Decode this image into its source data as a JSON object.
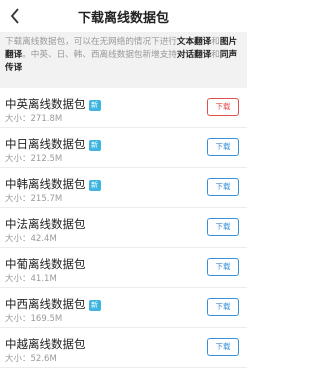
{
  "header": {
    "title": "下载离线数据包"
  },
  "notice": {
    "p1": "下载离线数据包，可以在无网络的情况下进行",
    "b1": "文本翻译",
    "p2": "和",
    "b2": "图片翻译",
    "p3": "。中英、日、韩、西离线数据包新增支持",
    "b3": "对话翻译",
    "p4": "和",
    "b4": "同声传译"
  },
  "size_prefix": "大小：",
  "packages": [
    {
      "name": "中英离线数据包",
      "badge": "新",
      "size": "271.8M",
      "button": "下载"
    },
    {
      "name": "中日离线数据包",
      "badge": "新",
      "size": "212.5M",
      "button": "下载"
    },
    {
      "name": "中韩离线数据包",
      "badge": "新",
      "size": "215.7M",
      "button": "下载"
    },
    {
      "name": "中法离线数据包",
      "badge": "",
      "size": "42.4M",
      "button": "下载"
    },
    {
      "name": "中葡离线数据包",
      "badge": "",
      "size": "41.1M",
      "button": "下载"
    },
    {
      "name": "中西离线数据包",
      "badge": "新",
      "size": "169.5M",
      "button": "下载"
    },
    {
      "name": "中越离线数据包",
      "badge": "",
      "size": "52.6M",
      "button": "下载"
    }
  ],
  "colors": {
    "accent": "#3a8fd9",
    "active_button": "#e05050",
    "badge": "#3eb4e0"
  }
}
